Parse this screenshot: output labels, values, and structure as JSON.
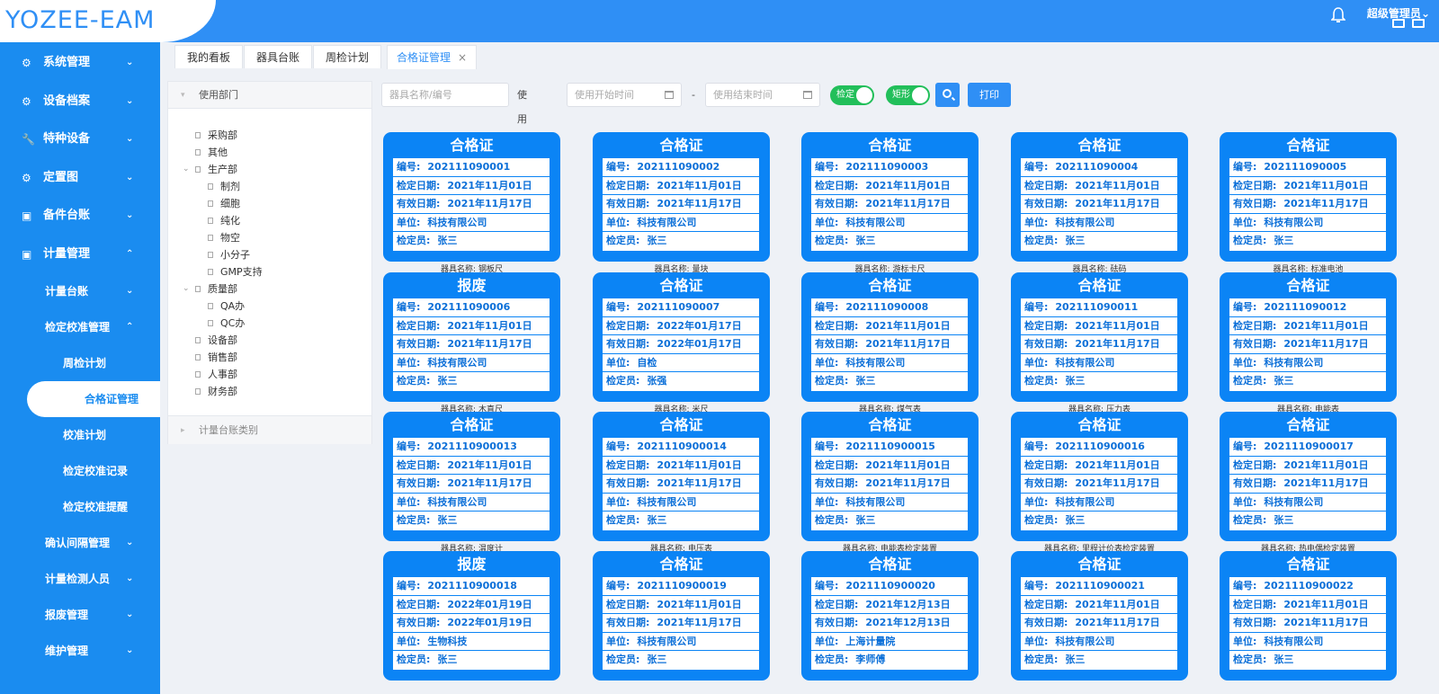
{
  "app": {
    "logo": "YOZEE-EAM",
    "user": "超级管理员",
    "user_arrow": "⌄"
  },
  "sidebar": {
    "items": [
      {
        "label": "系统管理",
        "icon": "⚙",
        "arrow": "⌄"
      },
      {
        "label": "设备档案",
        "icon": "⚙",
        "arrow": "⌄"
      },
      {
        "label": "特种设备",
        "icon": "🔧",
        "arrow": "⌄"
      },
      {
        "label": "定置图",
        "icon": "⚙",
        "arrow": "⌄"
      },
      {
        "label": "备件台账",
        "icon": "▣",
        "arrow": "⌄"
      },
      {
        "label": "计量管理",
        "icon": "▣",
        "arrow": "⌃"
      }
    ],
    "sub": [
      {
        "label": "计量台账",
        "arrow": "⌄"
      },
      {
        "label": "检定校准管理",
        "arrow": "⌃"
      }
    ],
    "sub3": [
      "周检计划"
    ],
    "active": "合格证管理",
    "sub3b": [
      "校准计划",
      "检定校准记录",
      "检定校准提醒"
    ],
    "sub2": [
      {
        "label": "确认间隔管理",
        "arrow": "⌄"
      },
      {
        "label": "计量检测人员",
        "arrow": "⌄"
      },
      {
        "label": "报废管理",
        "arrow": "⌄"
      },
      {
        "label": "维护管理",
        "arrow": "⌄"
      }
    ]
  },
  "tabs": [
    {
      "label": "我的看板"
    },
    {
      "label": "器具台账"
    },
    {
      "label": "周检计划"
    },
    {
      "label": "合格证管理",
      "close": "×"
    }
  ],
  "left_panel": {
    "header": "使用部门",
    "footer": "计量台账类别",
    "tree": [
      {
        "label": "采购部",
        "level": 0,
        "fold": ""
      },
      {
        "label": "其他",
        "level": 0,
        "fold": ""
      },
      {
        "label": "生产部",
        "level": 0,
        "fold": "⌄"
      },
      {
        "label": "制剂",
        "level": 1,
        "fold": ""
      },
      {
        "label": "细胞",
        "level": 1,
        "fold": ""
      },
      {
        "label": "纯化",
        "level": 1,
        "fold": ""
      },
      {
        "label": "物空",
        "level": 1,
        "fold": ""
      },
      {
        "label": "小分子",
        "level": 1,
        "fold": ""
      },
      {
        "label": "GMP支持",
        "level": 1,
        "fold": ""
      },
      {
        "label": "质量部",
        "level": 0,
        "fold": "⌄"
      },
      {
        "label": "QA办",
        "level": 1,
        "fold": ""
      },
      {
        "label": "QC办",
        "level": 1,
        "fold": ""
      },
      {
        "label": "设备部",
        "level": 0,
        "fold": ""
      },
      {
        "label": "销售部",
        "level": 0,
        "fold": ""
      },
      {
        "label": "人事部",
        "level": 0,
        "fold": ""
      },
      {
        "label": "财务部",
        "level": 0,
        "fold": ""
      }
    ]
  },
  "toolbar": {
    "name_placeholder": "器具名称/编号",
    "date_label": "使用日期:",
    "start_placeholder": "使用开始时间",
    "dash": "-",
    "end_placeholder": "使用结束时间",
    "toggle1": "检定",
    "toggle2": "矩形",
    "print": "打印"
  },
  "labels": {
    "no": "编号:",
    "check_date": "检定日期:",
    "valid_date": "有效日期:",
    "unit": "单位:",
    "inspector": "检定员:",
    "name_prefix": "器具名称:"
  },
  "cards": [
    {
      "title": "合格证",
      "no": "202111090001",
      "check": "2021年11月01日",
      "valid": "2021年11月17日",
      "unit": "科技有限公司",
      "inspector": "张三",
      "name": "钢板尺"
    },
    {
      "title": "合格证",
      "no": "202111090002",
      "check": "2021年11月01日",
      "valid": "2021年11月17日",
      "unit": "科技有限公司",
      "inspector": "张三",
      "name": "量块"
    },
    {
      "title": "合格证",
      "no": "202111090003",
      "check": "2021年11月01日",
      "valid": "2021年11月17日",
      "unit": "科技有限公司",
      "inspector": "张三",
      "name": "游标卡尺"
    },
    {
      "title": "合格证",
      "no": "202111090004",
      "check": "2021年11月01日",
      "valid": "2021年11月17日",
      "unit": "科技有限公司",
      "inspector": "张三",
      "name": "砝码"
    },
    {
      "title": "合格证",
      "no": "202111090005",
      "check": "2021年11月01日",
      "valid": "2021年11月17日",
      "unit": "科技有限公司",
      "inspector": "张三",
      "name": "标准电池"
    },
    {
      "title": "报废",
      "no": "202111090006",
      "check": "2021年11月01日",
      "valid": "2021年11月17日",
      "unit": "科技有限公司",
      "inspector": "张三",
      "name": "木直尺"
    },
    {
      "title": "合格证",
      "no": "202111090007",
      "check": "2022年01月17日",
      "valid": "2022年01月17日",
      "unit": "自检",
      "inspector": "张强",
      "name": "米尺"
    },
    {
      "title": "合格证",
      "no": "202111090008",
      "check": "2021年11月01日",
      "valid": "2021年11月17日",
      "unit": "科技有限公司",
      "inspector": "张三",
      "name": "煤气表"
    },
    {
      "title": "合格证",
      "no": "202111090011",
      "check": "2021年11月01日",
      "valid": "2021年11月17日",
      "unit": "科技有限公司",
      "inspector": "张三",
      "name": "压力表"
    },
    {
      "title": "合格证",
      "no": "202111090012",
      "check": "2021年11月01日",
      "valid": "2021年11月17日",
      "unit": "科技有限公司",
      "inspector": "张三",
      "name": "电能表"
    },
    {
      "title": "合格证",
      "no": "2021110900013",
      "check": "2021年11月01日",
      "valid": "2021年11月17日",
      "unit": "科技有限公司",
      "inspector": "张三",
      "name": "温度计"
    },
    {
      "title": "合格证",
      "no": "2021110900014",
      "check": "2021年11月01日",
      "valid": "2021年11月17日",
      "unit": "科技有限公司",
      "inspector": "张三",
      "name": "电压表"
    },
    {
      "title": "合格证",
      "no": "2021110900015",
      "check": "2021年11月01日",
      "valid": "2021年11月17日",
      "unit": "科技有限公司",
      "inspector": "张三",
      "name": "电能表检定装置"
    },
    {
      "title": "合格证",
      "no": "2021110900016",
      "check": "2021年11月01日",
      "valid": "2021年11月17日",
      "unit": "科技有限公司",
      "inspector": "张三",
      "name": "里程计价表检定装置"
    },
    {
      "title": "合格证",
      "no": "2021110900017",
      "check": "2021年11月01日",
      "valid": "2021年11月17日",
      "unit": "科技有限公司",
      "inspector": "张三",
      "name": "热电偶检定装置"
    },
    {
      "title": "报废",
      "no": "2021110900018",
      "check": "2022年01月19日",
      "valid": "2022年01月19日",
      "unit": "生物科技",
      "inspector": "张三",
      "name": ""
    },
    {
      "title": "合格证",
      "no": "2021110900019",
      "check": "2021年11月01日",
      "valid": "2021年11月17日",
      "unit": "科技有限公司",
      "inspector": "张三",
      "name": ""
    },
    {
      "title": "合格证",
      "no": "2021110900020",
      "check": "2021年12月13日",
      "valid": "2021年12月13日",
      "unit": "上海计量院",
      "inspector": "李师傅",
      "name": ""
    },
    {
      "title": "合格证",
      "no": "2021110900021",
      "check": "2021年11月01日",
      "valid": "2021年11月17日",
      "unit": "科技有限公司",
      "inspector": "张三",
      "name": ""
    },
    {
      "title": "合格证",
      "no": "2021110900022",
      "check": "2021年11月01日",
      "valid": "2021年11月17日",
      "unit": "科技有限公司",
      "inspector": "张三",
      "name": ""
    }
  ]
}
